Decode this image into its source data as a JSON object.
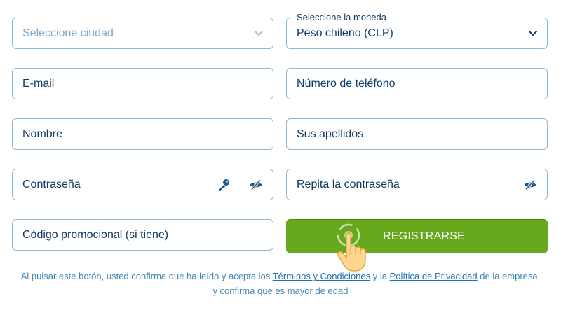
{
  "form": {
    "city": {
      "placeholder": "Seleccione ciudad"
    },
    "currency": {
      "label": "Seleccione la moneda",
      "value": "Peso chileno (CLP)"
    },
    "email": {
      "placeholder": "E-mail"
    },
    "phone": {
      "placeholder": "Número de teléfono"
    },
    "first_name": {
      "placeholder": "Nombre"
    },
    "last_name": {
      "placeholder": "Sus apellidos"
    },
    "password": {
      "placeholder": "Contraseña"
    },
    "password_repeat": {
      "placeholder": "Repita la contraseña"
    },
    "promo_code": {
      "placeholder": "Código promocional (si tiene)"
    },
    "register_button": "REGISTRARSE"
  },
  "legal": {
    "prefix": "Al pulsar este botón, usted confirma que ha leído y acepta los",
    "terms_link": "Términos y Condiciones",
    "connector": "y la",
    "privacy_link": "Política de Privacidad",
    "suffix_line1": "de la empresa,",
    "line2": "y confirma que es mayor de edad"
  },
  "colors": {
    "border": "#8fb8d6",
    "text": "#0f3b66",
    "placeholder": "#7ea9c9",
    "button": "#67a91d",
    "link": "#1f72b3"
  },
  "icons": [
    "chevron-down-icon",
    "key-icon",
    "eye-slash-icon",
    "hand-pointer-icon"
  ]
}
